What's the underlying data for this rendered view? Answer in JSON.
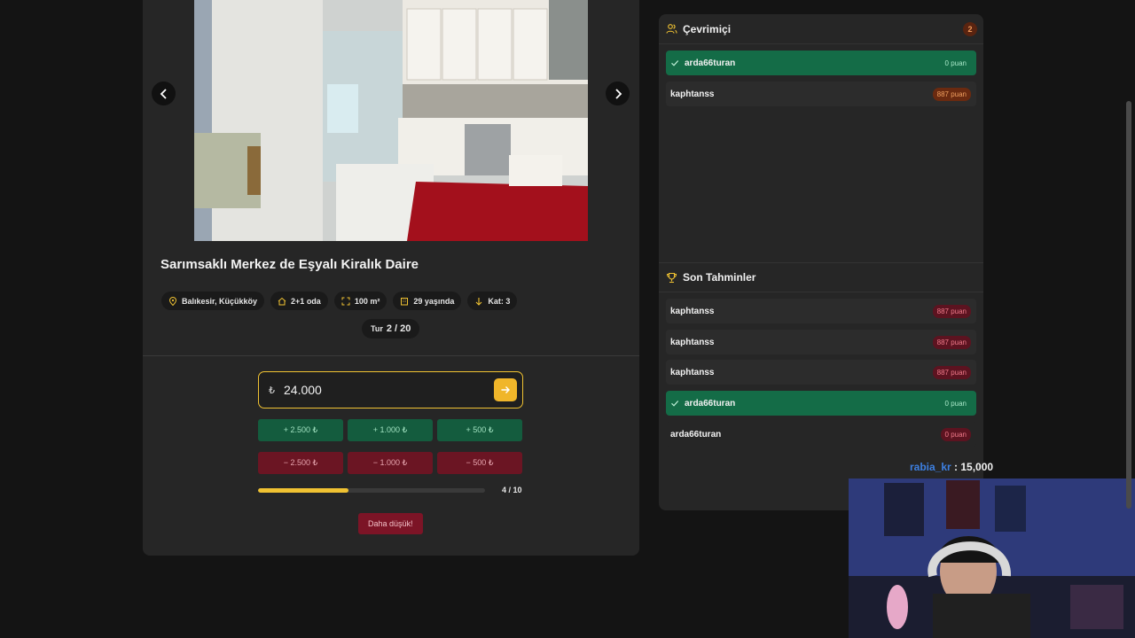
{
  "listing": {
    "title": "Sarımsaklı Merkez de Eşyalı Kiralık Daire",
    "chips": [
      {
        "icon": "location-pin-icon",
        "label": "Balıkesir, Küçükköy"
      },
      {
        "icon": "home-icon",
        "label": "2+1 oda"
      },
      {
        "icon": "area-icon",
        "label": "100 m²"
      },
      {
        "icon": "building-age-icon",
        "label": "29 yaşında"
      },
      {
        "icon": "arrow-down-icon",
        "label": "Kat: 3"
      }
    ],
    "round_label": "Tur",
    "round_value": "2 / 20"
  },
  "guess": {
    "currency": "₺",
    "value": "24.000",
    "plus": [
      "+ 2.500 ₺",
      "+ 1.000 ₺",
      "+ 500 ₺"
    ],
    "minus": [
      "− 2.500 ₺",
      "− 1.000 ₺",
      "− 500 ₺"
    ],
    "progress_fraction": 0.4,
    "progress_label": "4 / 10",
    "hint": "Daha düşük!"
  },
  "online": {
    "title": "Çevrimiçi",
    "count": "2",
    "players": [
      {
        "name": "arda66turan",
        "points": "0 puan",
        "status": "ok"
      },
      {
        "name": "kaphtanss",
        "points": "887 puan",
        "status": "orange"
      }
    ]
  },
  "recent": {
    "title": "Son Tahminler",
    "guesses": [
      {
        "name": "kaphtanss",
        "points": "887 puan",
        "status": "red"
      },
      {
        "name": "kaphtanss",
        "points": "887 puan",
        "status": "red"
      },
      {
        "name": "kaphtanss",
        "points": "887 puan",
        "status": "red"
      },
      {
        "name": "arda66turan",
        "points": "0 puan",
        "status": "ok"
      },
      {
        "name": "arda66turan",
        "points": "0 puan",
        "status": "red"
      }
    ]
  },
  "chat": {
    "user": "rabia_kr",
    "message": ": 15,000"
  },
  "colors": {
    "accent": "#f0c232",
    "success": "#146c47",
    "danger": "#6b1523",
    "chat_user": "#3d7fe0"
  }
}
